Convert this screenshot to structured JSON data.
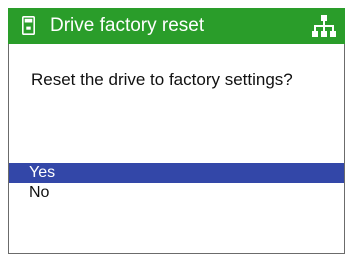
{
  "header": {
    "title": "Drive factory reset",
    "left_icon": "drive-icon",
    "right_icon": "network-tree-icon"
  },
  "dialog": {
    "question": "Reset the drive to factory settings?",
    "options": [
      {
        "label": "Yes",
        "selected": true
      },
      {
        "label": "No",
        "selected": false
      }
    ]
  },
  "colors": {
    "header_background": "#2a9d2a",
    "selection_background": "#3347a8",
    "selection_text": "#ffffff",
    "border": "#6b6b6b"
  }
}
